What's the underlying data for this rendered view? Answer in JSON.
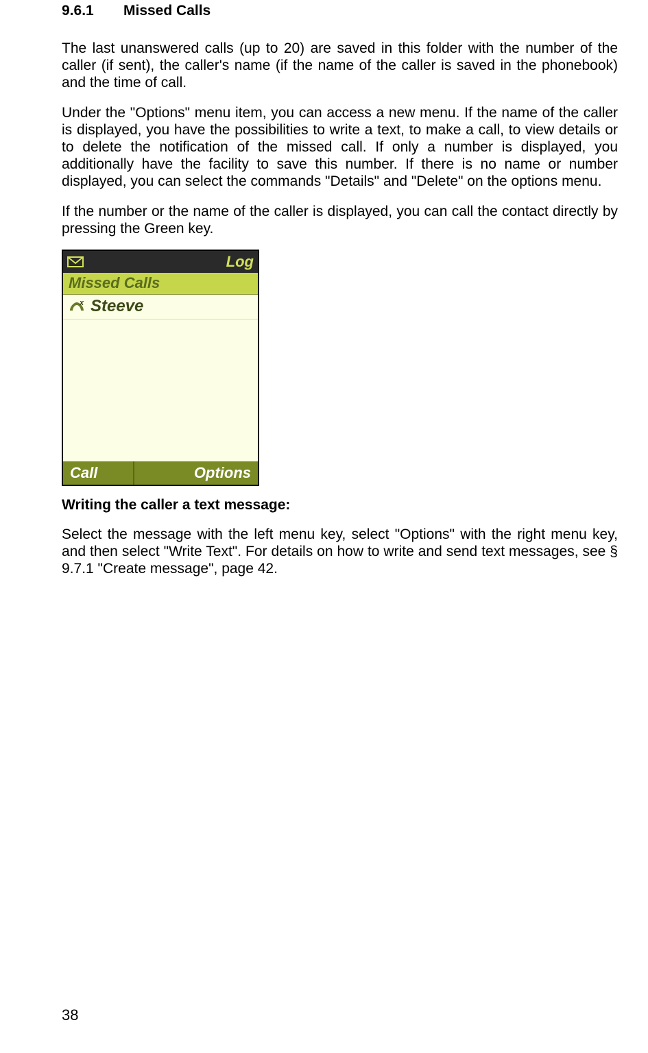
{
  "heading": {
    "number": "9.6.1",
    "title": "Missed Calls"
  },
  "paragraphs": {
    "p1": "The last unanswered calls (up to 20) are saved in this folder with the number of the caller (if sent), the caller's name (if the name of the caller is saved in the phonebook) and the time of call.",
    "p2": "Under the \"Options\" menu item, you can access a new menu. If the name of the caller is displayed, you have the possibilities to write a text, to make a call, to view details or to delete the notification of the missed call. If only a number is displayed, you additionally have the facility to save this number. If there is no name or number displayed, you can select the commands \"Details\" and \"Delete\" on the options menu.",
    "p3": "If the number or the name of the caller is displayed, you can call the contact directly by pressing the Green key."
  },
  "phone": {
    "status_title": "Log",
    "header": "Missed Calls",
    "entry_name": "Steeve",
    "softkey_left": "Call",
    "softkey_right": "Options"
  },
  "subhead": "Writing the caller a text  message:",
  "paragraphs2": {
    "p4": "Select the message with the left menu key, select \"Options\" with the right menu key, and then select \"Write Text\". For details on how to write and send text messages, see § 9.7.1 \"Create message\", page 42."
  },
  "page_number": "38"
}
